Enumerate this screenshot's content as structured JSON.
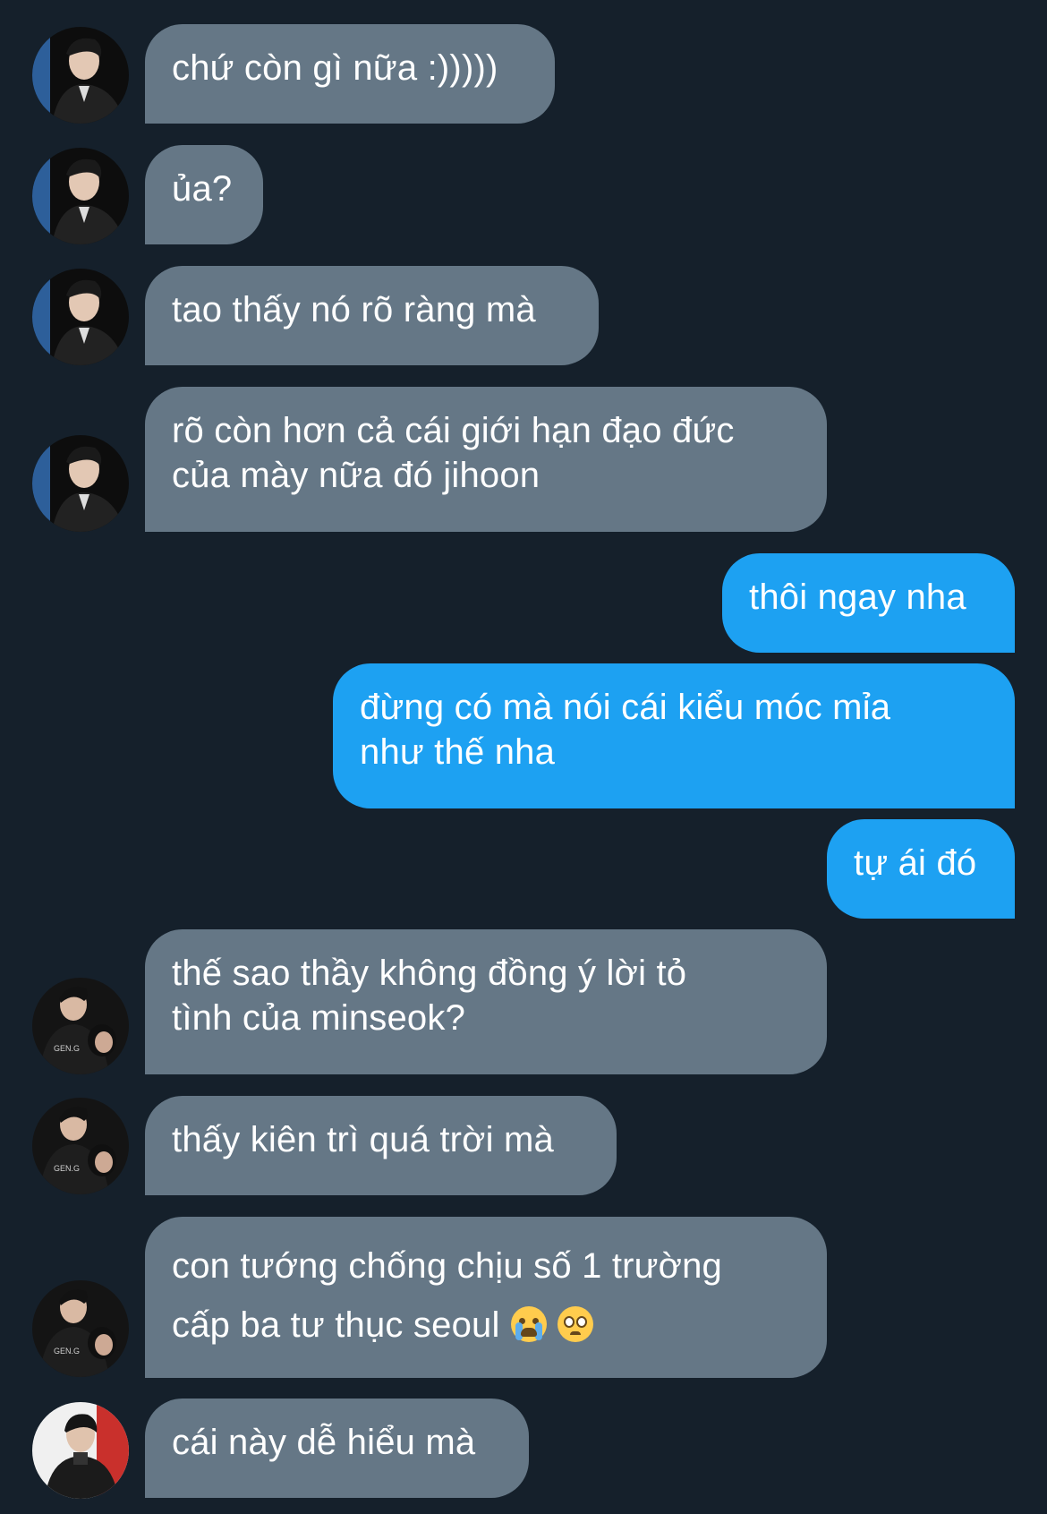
{
  "theme": {
    "background": "#15202b",
    "incoming_bubble": "#657786",
    "outgoing_bubble": "#1da1f2",
    "text": "#ffffff"
  },
  "messages": [
    {
      "direction": "incoming",
      "avatar": "avatar-user-a",
      "lines": [
        "chứ còn gì nữa :)))))"
      ]
    },
    {
      "direction": "incoming",
      "avatar": "avatar-user-a",
      "lines": [
        "ủa?"
      ]
    },
    {
      "direction": "incoming",
      "avatar": "avatar-user-a",
      "lines": [
        "tao thấy nó rõ ràng mà"
      ]
    },
    {
      "direction": "incoming",
      "avatar": "avatar-user-a",
      "lines": [
        "rõ còn hơn cả cái giới hạn đạo đức",
        "của mày nữa đó jihoon"
      ]
    },
    {
      "direction": "outgoing",
      "lines": [
        "thôi ngay nha"
      ]
    },
    {
      "direction": "outgoing",
      "lines": [
        "đừng có mà nói cái kiểu móc mỉa",
        "như thế nha"
      ]
    },
    {
      "direction": "outgoing",
      "lines": [
        "tự ái đó"
      ]
    },
    {
      "direction": "incoming",
      "avatar": "avatar-user-b",
      "lines": [
        "thế sao thầy không đồng ý lời tỏ",
        "tình của minseok?"
      ]
    },
    {
      "direction": "incoming",
      "avatar": "avatar-user-b",
      "lines": [
        "thấy kiên trì quá trời mà"
      ]
    },
    {
      "direction": "incoming",
      "avatar": "avatar-user-b",
      "lines": [
        "con tướng chống chịu số 1 trường",
        "cấp ba tư thục seoul"
      ],
      "emoji": [
        "loudly-crying-face-emoji",
        "pleading-face-emoji"
      ]
    },
    {
      "direction": "incoming",
      "avatar": "avatar-user-c",
      "lines": [
        "cái này dễ hiểu mà"
      ]
    }
  ]
}
